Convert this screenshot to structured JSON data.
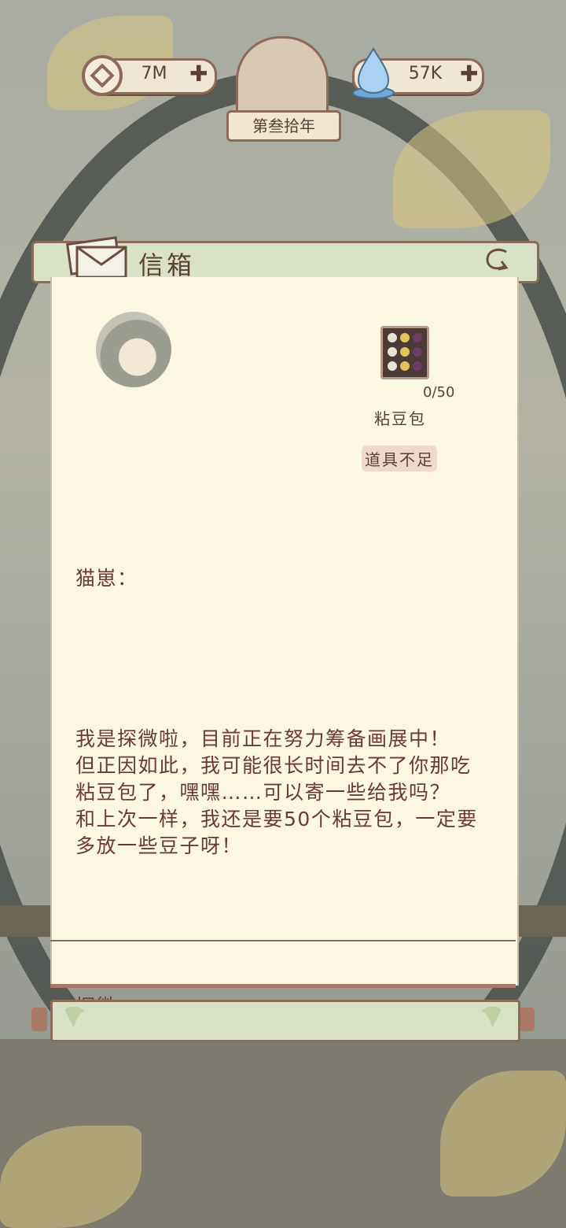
{
  "resources": {
    "coins": {
      "value": "7M",
      "add": "✚",
      "icon": "coin-icon"
    },
    "water": {
      "value": "57K",
      "add": "✚",
      "icon": "water-drop-icon"
    }
  },
  "year_label": "第叁拾年",
  "mailbox": {
    "title": "信箱",
    "request": {
      "item_name": "粘豆包",
      "progress": "0/50",
      "status": "道具不足"
    },
    "letter": {
      "greeting": "猫崽：",
      "body": "我是探微啦，目前正在努力筹备画展中！\n但正因如此，我可能很长时间去不了你那吃粘豆包了，嘿嘿……可以寄一些给我吗？\n和上次一样，我还是要50个粘豆包，一定要多放一些豆子呀！",
      "signature": "探微"
    }
  },
  "colors": {
    "paper": "#fbf7e3",
    "ink": "#6b3b2c",
    "band": "#d9e2c6",
    "frame": "#8c6b5a"
  }
}
